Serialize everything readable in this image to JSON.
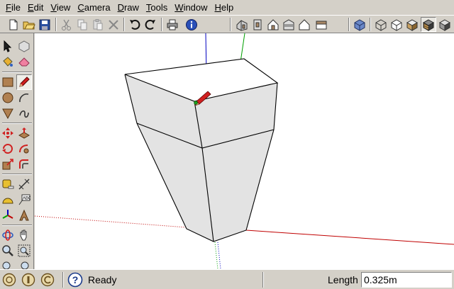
{
  "menu": [
    {
      "pre": "",
      "key": "F",
      "post": "ile"
    },
    {
      "pre": "",
      "key": "E",
      "post": "dit"
    },
    {
      "pre": "",
      "key": "V",
      "post": "iew"
    },
    {
      "pre": "",
      "key": "C",
      "post": "amera"
    },
    {
      "pre": "",
      "key": "D",
      "post": "raw"
    },
    {
      "pre": "",
      "key": "T",
      "post": "ools"
    },
    {
      "pre": "",
      "key": "W",
      "post": "indow"
    },
    {
      "pre": "",
      "key": "H",
      "post": "elp"
    }
  ],
  "status": {
    "message": "Ready",
    "measurement_label": "Length",
    "measurement_value": "0.325m"
  },
  "colors": {
    "face": "#e3e3e3",
    "edge": "#000000",
    "axis_red": "#c00000",
    "axis_green": "#00a000",
    "axis_blue": "#0000c0"
  }
}
